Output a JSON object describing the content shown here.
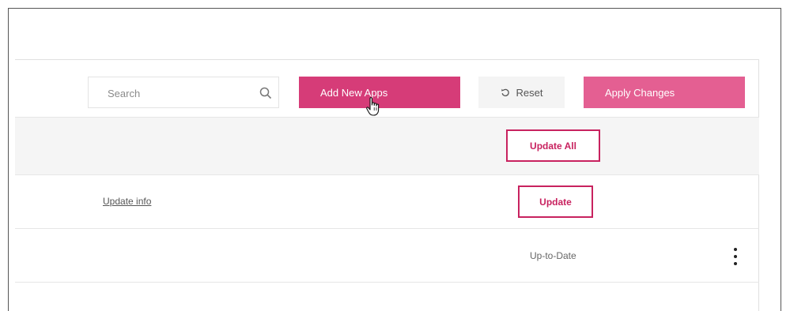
{
  "toolbar": {
    "search": {
      "placeholder": "Search",
      "value": ""
    },
    "add_new_apps_label": "Add New Apps",
    "reset_label": "Reset",
    "apply_changes_label": "Apply Changes"
  },
  "table": {
    "header": {
      "update_all_label": "Update All"
    },
    "rows": [
      {
        "info_link": "Update info",
        "action_label": "Update"
      },
      {
        "status": "Up-to-Date"
      }
    ]
  },
  "colors": {
    "primary_button": "#d63c78",
    "apply_button": "#e45f92",
    "outline_accent": "#c8225f"
  },
  "icons": {
    "search": "search-icon",
    "reset": "reset-icon",
    "more": "more-vertical-icon",
    "cursor": "hand-pointer-icon"
  }
}
